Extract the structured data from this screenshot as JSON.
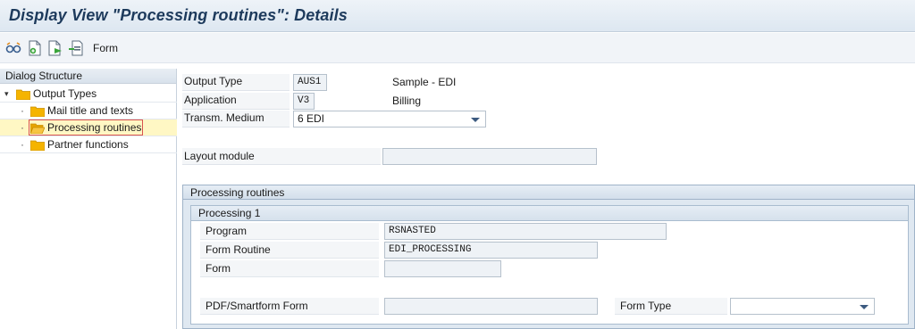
{
  "window": {
    "title": "Display View \"Processing routines\": Details"
  },
  "toolbar": {
    "icons": [
      "glasses-other-view-icon",
      "new-entries-icon",
      "copy-as-icon",
      "delete-icon"
    ],
    "form_label": "Form"
  },
  "dialog_structure": {
    "header": "Dialog Structure",
    "root": "Output Types",
    "children": [
      "Mail title and texts",
      "Processing routines",
      "Partner functions"
    ],
    "selected": "Processing routines"
  },
  "details": {
    "output_type": {
      "label": "Output Type",
      "value": "AUS1",
      "description": "Sample - EDI"
    },
    "application": {
      "label": "Application",
      "value": "V3",
      "description": "Billing"
    },
    "transm_medium": {
      "label": "Transm. Medium",
      "value": "6 EDI"
    },
    "layout_module": {
      "label": "Layout module",
      "value": ""
    }
  },
  "processing_routines": {
    "header": "Processing routines",
    "processing1": {
      "header": "Processing 1",
      "program": {
        "label": "Program",
        "value": "RSNASTED"
      },
      "form_routine": {
        "label": "Form Routine",
        "value": "EDI_PROCESSING"
      },
      "form": {
        "label": "Form",
        "value": ""
      },
      "pdf_smartform": {
        "label": "PDF/Smartform Form",
        "value": ""
      },
      "form_type": {
        "label": "Form Type",
        "value": ""
      }
    }
  },
  "colors": {
    "title_text": "#1d3a5c",
    "selection_bg": "#fff7c4",
    "folder": "#f5b400",
    "selected_outline": "#d9534f"
  }
}
